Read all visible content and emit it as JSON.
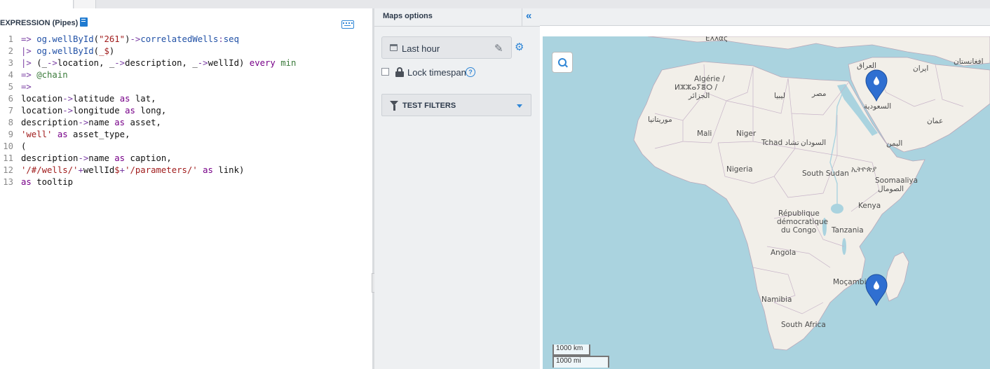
{
  "editor": {
    "header": "EXPRESSION (Pipes)",
    "book_icon": "book-icon",
    "keyboard_icon": "keyboard-icon",
    "lines": [
      {
        "n": "1",
        "segs": [
          {
            "c": "op",
            "t": "=> "
          },
          {
            "c": "fn",
            "t": "og.wellById"
          },
          {
            "c": "id",
            "t": "("
          },
          {
            "c": "str",
            "t": "\"261\""
          },
          {
            "c": "id",
            "t": ")"
          },
          {
            "c": "op",
            "t": "->"
          },
          {
            "c": "fn",
            "t": "correlatedWells"
          },
          {
            "c": "op",
            "t": ":"
          },
          {
            "c": "fn",
            "t": "seq"
          }
        ]
      },
      {
        "n": "2",
        "segs": [
          {
            "c": "op",
            "t": "|> "
          },
          {
            "c": "fn",
            "t": "og.wellById"
          },
          {
            "c": "id",
            "t": "("
          },
          {
            "c": "str",
            "t": "_$"
          },
          {
            "c": "id",
            "t": ")"
          }
        ]
      },
      {
        "n": "3",
        "segs": [
          {
            "c": "op",
            "t": "|> "
          },
          {
            "c": "id",
            "t": "(_"
          },
          {
            "c": "op",
            "t": "->"
          },
          {
            "c": "id",
            "t": "location, _"
          },
          {
            "c": "op",
            "t": "->"
          },
          {
            "c": "id",
            "t": "description, _"
          },
          {
            "c": "op",
            "t": "->"
          },
          {
            "c": "id",
            "t": "wellId) "
          },
          {
            "c": "kw",
            "t": "every "
          },
          {
            "c": "cm",
            "t": "min"
          }
        ]
      },
      {
        "n": "4",
        "segs": [
          {
            "c": "op",
            "t": "=> "
          },
          {
            "c": "cm",
            "t": "@chain"
          }
        ]
      },
      {
        "n": "5",
        "segs": [
          {
            "c": "op",
            "t": "=>"
          }
        ]
      },
      {
        "n": "6",
        "segs": [
          {
            "c": "id",
            "t": "location"
          },
          {
            "c": "op",
            "t": "->"
          },
          {
            "c": "id",
            "t": "latitude "
          },
          {
            "c": "kw",
            "t": "as"
          },
          {
            "c": "id",
            "t": " lat,"
          }
        ]
      },
      {
        "n": "7",
        "segs": [
          {
            "c": "id",
            "t": "location"
          },
          {
            "c": "op",
            "t": "->"
          },
          {
            "c": "id",
            "t": "longitude "
          },
          {
            "c": "kw",
            "t": "as"
          },
          {
            "c": "id",
            "t": " long,"
          }
        ]
      },
      {
        "n": "8",
        "segs": [
          {
            "c": "id",
            "t": "description"
          },
          {
            "c": "op",
            "t": "->"
          },
          {
            "c": "id",
            "t": "name "
          },
          {
            "c": "kw",
            "t": "as"
          },
          {
            "c": "id",
            "t": " asset,"
          }
        ]
      },
      {
        "n": "9",
        "segs": [
          {
            "c": "str",
            "t": "'well'"
          },
          {
            "c": "id",
            "t": " "
          },
          {
            "c": "kw",
            "t": "as"
          },
          {
            "c": "id",
            "t": " asset_type,"
          }
        ]
      },
      {
        "n": "10",
        "segs": [
          {
            "c": "id",
            "t": "("
          }
        ]
      },
      {
        "n": "11",
        "segs": [
          {
            "c": "id",
            "t": "description"
          },
          {
            "c": "op",
            "t": "->"
          },
          {
            "c": "id",
            "t": "name "
          },
          {
            "c": "kw",
            "t": "as"
          },
          {
            "c": "id",
            "t": " caption,"
          }
        ]
      },
      {
        "n": "12",
        "segs": [
          {
            "c": "str",
            "t": "'/#/wells/'"
          },
          {
            "c": "op",
            "t": "+"
          },
          {
            "c": "id",
            "t": "wellId"
          },
          {
            "c": "str",
            "t": "$"
          },
          {
            "c": "op",
            "t": "+"
          },
          {
            "c": "str",
            "t": "'/parameters/'"
          },
          {
            "c": "id",
            "t": " "
          },
          {
            "c": "kw",
            "t": "as"
          },
          {
            "c": "id",
            "t": " link)"
          }
        ]
      },
      {
        "n": "13",
        "segs": [
          {
            "c": "kw",
            "t": "as"
          },
          {
            "c": "id",
            "t": " tooltip"
          }
        ]
      }
    ]
  },
  "options": {
    "title": "Maps options",
    "collapse_glyph": "«",
    "time_range": "Last hour",
    "lock_label": "Lock timespan",
    "help_glyph": "?",
    "filters_label": "TEST FILTERS"
  },
  "map": {
    "labels": [
      {
        "t": "Ελλάς"
      },
      {
        "t": "العراق"
      },
      {
        "t": "ایران"
      },
      {
        "t": "افغانستان"
      },
      {
        "t": "Algérie /"
      },
      {
        "t": "ⵍⵣⵣⴰⵢⴻⵔ /"
      },
      {
        "t": "الجزائر"
      },
      {
        "t": "ليبيا"
      },
      {
        "t": "مصر"
      },
      {
        "t": "السعودية"
      },
      {
        "t": "موريتانيا"
      },
      {
        "t": "Mali"
      },
      {
        "t": "Niger"
      },
      {
        "t": "Tchad تشاد"
      },
      {
        "t": "السودان"
      },
      {
        "t": "عمان"
      },
      {
        "t": "اليمن"
      },
      {
        "t": "Nigeria"
      },
      {
        "t": "South Sudan"
      },
      {
        "t": "ኢትዮጵያ"
      },
      {
        "t": "Soomaaliya"
      },
      {
        "t": "الصومال"
      },
      {
        "t": "Kenya"
      },
      {
        "t": "République"
      },
      {
        "t": "démocratique"
      },
      {
        "t": "du Congo"
      },
      {
        "t": "Tanzania"
      },
      {
        "t": "Angola"
      },
      {
        "t": "Moçambique"
      },
      {
        "t": "Namibia"
      },
      {
        "t": "South Africa"
      }
    ],
    "scale_km": "1000 km",
    "scale_mi": "1000 mi",
    "pin_color": "#2f6fd1"
  }
}
